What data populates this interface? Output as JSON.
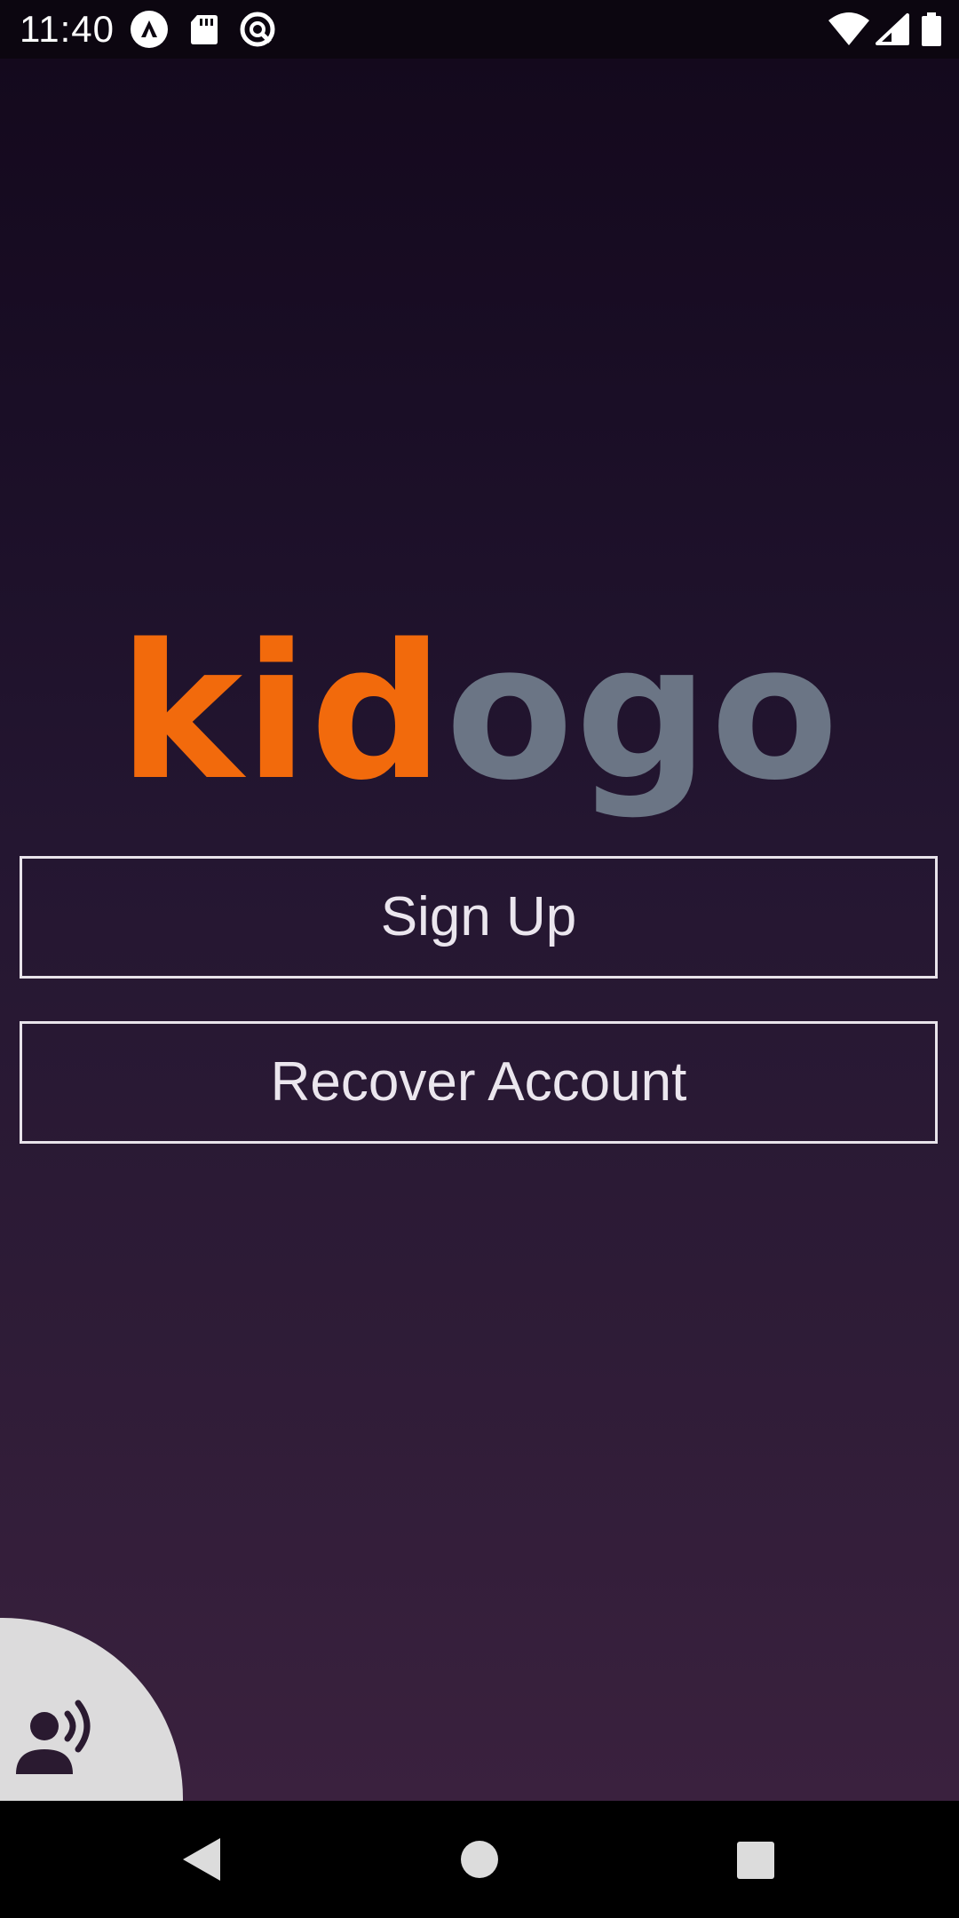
{
  "status_bar": {
    "time": "11:40",
    "left_icons": [
      "accessibility-icon",
      "sd-card-icon",
      "sync-icon"
    ],
    "right_icons": [
      "wifi-icon",
      "cell-signal-icon",
      "battery-icon"
    ]
  },
  "logo": {
    "part1": "kid",
    "part2": "ogo",
    "colors": {
      "part1": "#f26a0c",
      "part2": "#6b7585"
    }
  },
  "buttons": {
    "sign_up": "Sign Up",
    "recover_account": "Recover Account"
  },
  "voice_assistant": {
    "icon": "voice-person-icon"
  },
  "nav_bar": {
    "icons": [
      "back-icon",
      "home-icon",
      "recents-icon"
    ]
  }
}
